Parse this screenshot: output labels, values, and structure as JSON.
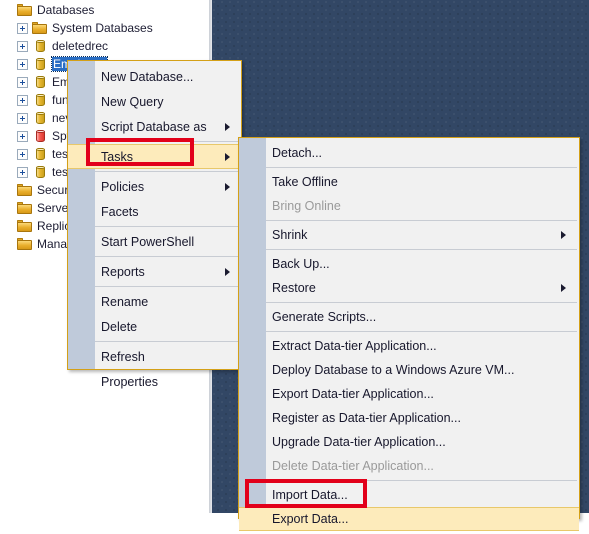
{
  "theme": {
    "canvas_bg": "#324765",
    "menu_bg": "#f1f1f1",
    "menu_border": "#d4a017",
    "menu_gutter": "#bfcada",
    "highlight_bg": "#fdebbb",
    "highlight_border": "#e8c86a",
    "selection_bg": "#2a6ec4",
    "annotation_color": "#e2001a",
    "disabled_text": "#9a9a9a",
    "text": "#17172c"
  },
  "object_explorer": {
    "name": "Object Explorer tree",
    "nodes": [
      {
        "label": "Databases",
        "indent": 0,
        "icon": "folder-icon",
        "expander": false,
        "selected": false
      },
      {
        "label": "System Databases",
        "indent": 1,
        "icon": "folder-icon",
        "expander": true,
        "selected": false
      },
      {
        "label": "deletedrec",
        "indent": 1,
        "icon": "database-icon",
        "expander": true,
        "selected": false
      },
      {
        "label": "Employee",
        "indent": 1,
        "icon": "database-icon",
        "expander": true,
        "selected": true
      },
      {
        "label": "Em",
        "indent": 1,
        "icon": "database-icon",
        "expander": true,
        "selected": false
      },
      {
        "label": "fun",
        "indent": 1,
        "icon": "database-icon",
        "expander": true,
        "selected": false
      },
      {
        "label": "nev",
        "indent": 1,
        "icon": "database-icon",
        "expander": true,
        "selected": false
      },
      {
        "label": "Spt",
        "indent": 1,
        "icon": "database-icon-red",
        "expander": true,
        "selected": false
      },
      {
        "label": "test",
        "indent": 1,
        "icon": "database-icon",
        "expander": true,
        "selected": false
      },
      {
        "label": "test",
        "indent": 1,
        "icon": "database-icon",
        "expander": true,
        "selected": false
      },
      {
        "label": "Security",
        "indent": 0,
        "icon": "folder-icon",
        "expander": false,
        "selected": false
      },
      {
        "label": "Server ",
        "indent": 0,
        "icon": "folder-icon",
        "expander": false,
        "selected": false
      },
      {
        "label": "Replica",
        "indent": 0,
        "icon": "folder-icon",
        "expander": false,
        "selected": false
      },
      {
        "label": "Manag",
        "indent": 0,
        "icon": "folder-icon",
        "expander": false,
        "selected": false
      }
    ]
  },
  "context_menu": {
    "name": "database-context-menu",
    "items": [
      {
        "label": "New Database...",
        "type": "item",
        "submenu": false,
        "highlighted": false
      },
      {
        "label": "New Query",
        "type": "item",
        "submenu": false,
        "highlighted": false
      },
      {
        "label": "Script Database as",
        "type": "item",
        "submenu": true,
        "highlighted": false
      },
      {
        "label": "",
        "type": "separator"
      },
      {
        "label": "Tasks",
        "type": "item",
        "submenu": true,
        "highlighted": true
      },
      {
        "label": "",
        "type": "separator"
      },
      {
        "label": "Policies",
        "type": "item",
        "submenu": true,
        "highlighted": false
      },
      {
        "label": "Facets",
        "type": "item",
        "submenu": false,
        "highlighted": false
      },
      {
        "label": "",
        "type": "separator"
      },
      {
        "label": "Start PowerShell",
        "type": "item",
        "submenu": false,
        "highlighted": false
      },
      {
        "label": "",
        "type": "separator"
      },
      {
        "label": "Reports",
        "type": "item",
        "submenu": true,
        "highlighted": false
      },
      {
        "label": "",
        "type": "separator"
      },
      {
        "label": "Rename",
        "type": "item",
        "submenu": false,
        "highlighted": false
      },
      {
        "label": "Delete",
        "type": "item",
        "submenu": false,
        "highlighted": false
      },
      {
        "label": "",
        "type": "separator"
      },
      {
        "label": "Refresh",
        "type": "item",
        "submenu": false,
        "highlighted": false
      },
      {
        "label": "Properties",
        "type": "item",
        "submenu": false,
        "highlighted": false
      }
    ]
  },
  "tasks_submenu": {
    "name": "tasks-submenu",
    "items": [
      {
        "label": "Detach...",
        "type": "item",
        "submenu": false,
        "disabled": false,
        "highlighted": false
      },
      {
        "label": "",
        "type": "separator"
      },
      {
        "label": "Take Offline",
        "type": "item",
        "submenu": false,
        "disabled": false,
        "highlighted": false
      },
      {
        "label": "Bring Online",
        "type": "item",
        "submenu": false,
        "disabled": true,
        "highlighted": false
      },
      {
        "label": "",
        "type": "separator"
      },
      {
        "label": "Shrink",
        "type": "item",
        "submenu": true,
        "disabled": false,
        "highlighted": false
      },
      {
        "label": "",
        "type": "separator"
      },
      {
        "label": "Back Up...",
        "type": "item",
        "submenu": false,
        "disabled": false,
        "highlighted": false
      },
      {
        "label": "Restore",
        "type": "item",
        "submenu": true,
        "disabled": false,
        "highlighted": false
      },
      {
        "label": "",
        "type": "separator"
      },
      {
        "label": "Generate Scripts...",
        "type": "item",
        "submenu": false,
        "disabled": false,
        "highlighted": false
      },
      {
        "label": "",
        "type": "separator"
      },
      {
        "label": "Extract Data-tier Application...",
        "type": "item",
        "submenu": false,
        "disabled": false,
        "highlighted": false
      },
      {
        "label": "Deploy Database to a Windows Azure VM...",
        "type": "item",
        "submenu": false,
        "disabled": false,
        "highlighted": false
      },
      {
        "label": "Export Data-tier Application...",
        "type": "item",
        "submenu": false,
        "disabled": false,
        "highlighted": false
      },
      {
        "label": "Register as Data-tier Application...",
        "type": "item",
        "submenu": false,
        "disabled": false,
        "highlighted": false
      },
      {
        "label": "Upgrade Data-tier Application...",
        "type": "item",
        "submenu": false,
        "disabled": false,
        "highlighted": false
      },
      {
        "label": "Delete Data-tier Application...",
        "type": "item",
        "submenu": false,
        "disabled": true,
        "highlighted": false
      },
      {
        "label": "",
        "type": "separator"
      },
      {
        "label": "Import Data...",
        "type": "item",
        "submenu": false,
        "disabled": false,
        "highlighted": false
      },
      {
        "label": "Export Data...",
        "type": "item",
        "submenu": false,
        "disabled": false,
        "highlighted": true
      }
    ]
  },
  "annotations": [
    {
      "name": "annotation-tasks",
      "target": "Tasks"
    },
    {
      "name": "annotation-export",
      "target": "Export Data..."
    }
  ]
}
